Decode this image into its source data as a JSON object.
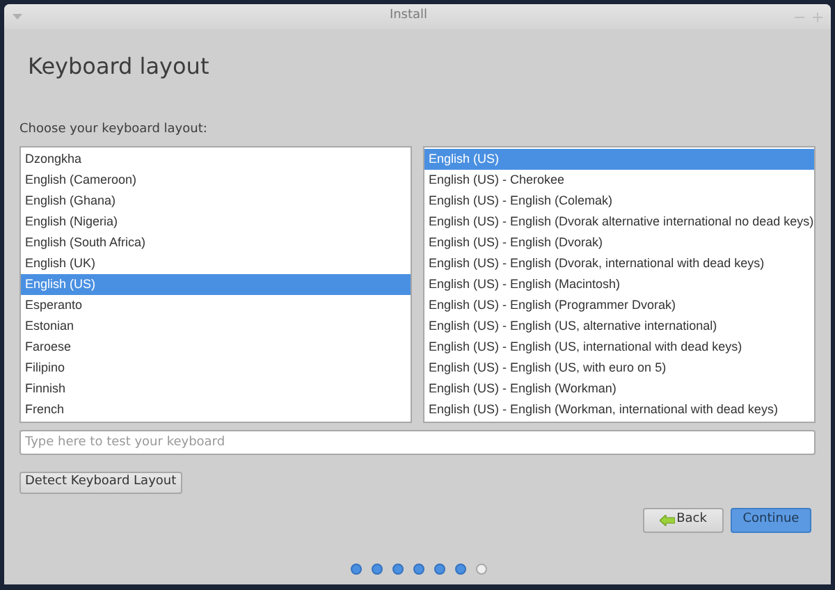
{
  "window": {
    "title": "Install"
  },
  "heading": "Keyboard layout",
  "prompt": "Choose your keyboard layout:",
  "layouts": [
    {
      "label": "Dzongkha",
      "selected": false
    },
    {
      "label": "English (Cameroon)",
      "selected": false
    },
    {
      "label": "English (Ghana)",
      "selected": false
    },
    {
      "label": "English (Nigeria)",
      "selected": false
    },
    {
      "label": "English (South Africa)",
      "selected": false
    },
    {
      "label": "English (UK)",
      "selected": false
    },
    {
      "label": "English (US)",
      "selected": true
    },
    {
      "label": "Esperanto",
      "selected": false
    },
    {
      "label": "Estonian",
      "selected": false
    },
    {
      "label": "Faroese",
      "selected": false
    },
    {
      "label": "Filipino",
      "selected": false
    },
    {
      "label": "Finnish",
      "selected": false
    },
    {
      "label": "French",
      "selected": false
    }
  ],
  "variants": [
    {
      "label": "English (US)",
      "selected": true
    },
    {
      "label": "English (US) - Cherokee",
      "selected": false
    },
    {
      "label": "English (US) - English (Colemak)",
      "selected": false
    },
    {
      "label": "English (US) - English (Dvorak alternative international no dead keys)",
      "selected": false
    },
    {
      "label": "English (US) - English (Dvorak)",
      "selected": false
    },
    {
      "label": "English (US) - English (Dvorak, international with dead keys)",
      "selected": false
    },
    {
      "label": "English (US) - English (Macintosh)",
      "selected": false
    },
    {
      "label": "English (US) - English (Programmer Dvorak)",
      "selected": false
    },
    {
      "label": "English (US) - English (US, alternative international)",
      "selected": false
    },
    {
      "label": "English (US) - English (US, international with dead keys)",
      "selected": false
    },
    {
      "label": "English (US) - English (US, with euro on 5)",
      "selected": false
    },
    {
      "label": "English (US) - English (Workman)",
      "selected": false
    },
    {
      "label": "English (US) - English (Workman, international with dead keys)",
      "selected": false
    }
  ],
  "test_field": {
    "placeholder": "Type here to test your keyboard"
  },
  "detect_button": "Detect Keyboard Layout",
  "buttons": [
    {
      "label": "Back",
      "kind": "back"
    },
    {
      "label": "Continue",
      "kind": "primary"
    }
  ],
  "progress_steps": [
    {
      "done": true
    },
    {
      "done": true
    },
    {
      "done": true
    },
    {
      "done": true
    },
    {
      "done": true
    },
    {
      "done": true
    },
    {
      "done": false
    }
  ]
}
